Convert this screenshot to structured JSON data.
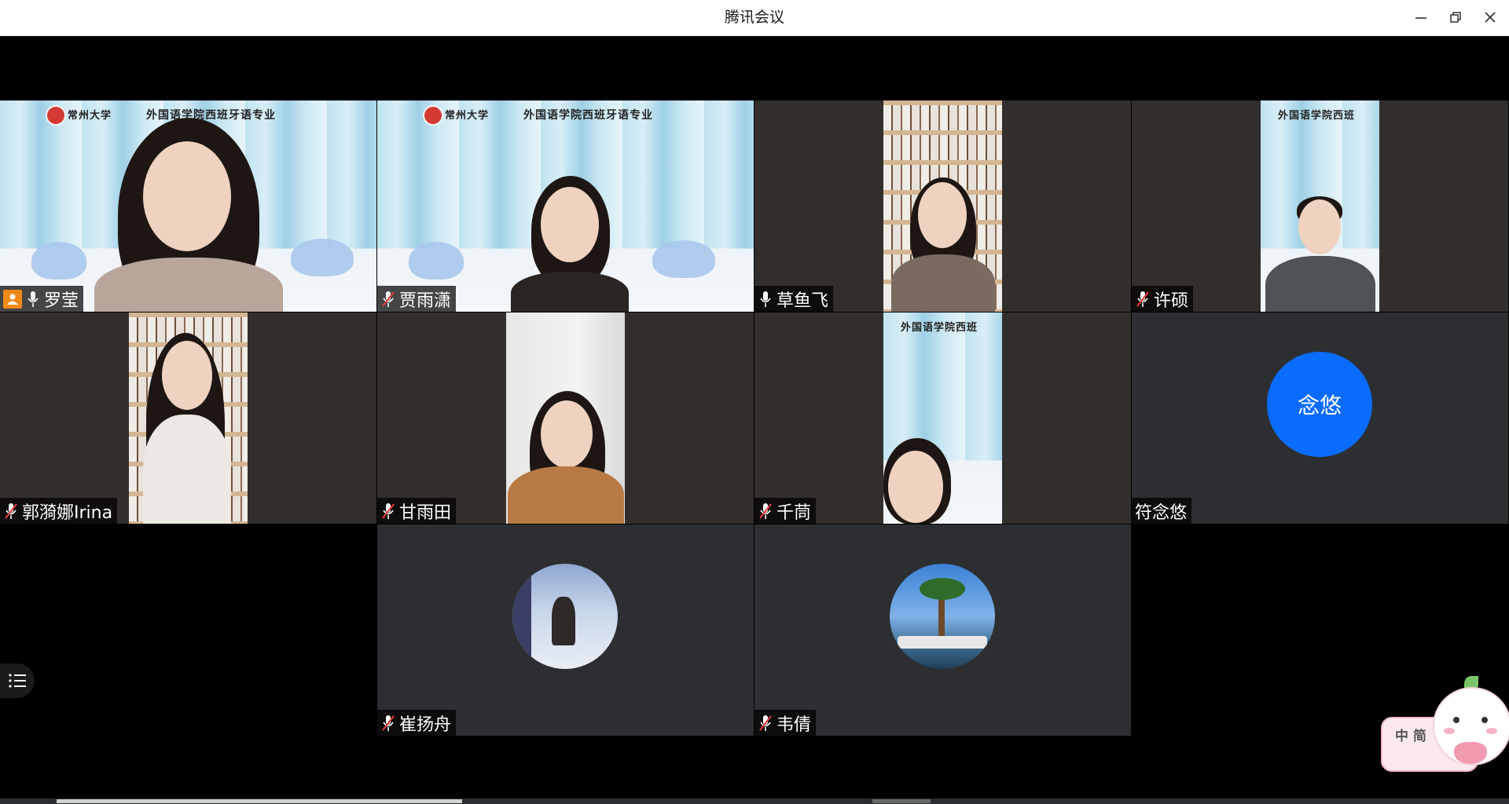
{
  "window": {
    "title": "腾讯会议"
  },
  "tiles": [
    {
      "name": "罗莹",
      "mic": "on",
      "host": true,
      "banner": "外国语学院西班牙语专业",
      "banner_prefix": "常州大学"
    },
    {
      "name": "贾雨潇",
      "mic": "muted",
      "banner": "外国语学院西班牙语专业",
      "banner_prefix": "常州大学"
    },
    {
      "name": "草鱼飞",
      "mic": "on"
    },
    {
      "name": "许硕",
      "mic": "muted",
      "banner": "外国语学院西班"
    },
    {
      "name": "郭漪娜Irina",
      "mic": "muted"
    },
    {
      "name": "甘雨田",
      "mic": "muted"
    },
    {
      "name": "千茼",
      "mic": "muted",
      "banner": "外国语学院西班"
    },
    {
      "name": "符念悠",
      "mic": "none",
      "avatar_text": "念悠"
    },
    {
      "name": "崔扬舟",
      "mic": "muted"
    },
    {
      "name": "韦倩",
      "mic": "muted"
    }
  ],
  "ime": {
    "text": "中 简"
  },
  "colors": {
    "host_badge": "#f08a17",
    "active_speaker": "#1fbf63",
    "avatar_blue": "#0a6cff",
    "muted_red": "#e23b3b"
  }
}
